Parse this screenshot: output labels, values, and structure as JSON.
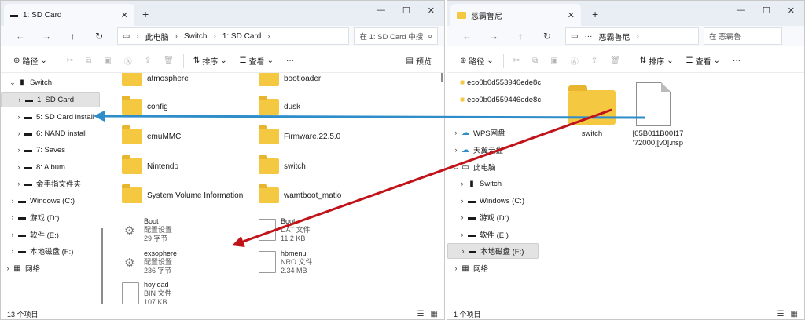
{
  "colors": {
    "blue_arrow": "#2f8ec9",
    "red_arrow": "#c0131a",
    "folder": "#f5c842"
  },
  "left": {
    "tab_title": "1: SD Card",
    "nav_buttons": [
      "←",
      "→",
      "↑",
      "↻"
    ],
    "breadcrumb": [
      "此电脑",
      "Switch",
      "1: SD Card"
    ],
    "search_placeholder": "在 1: SD Card 中搜",
    "toolbar": {
      "path": "路径",
      "sort": "排序",
      "view": "查看",
      "more": "···",
      "preview": "预览"
    },
    "nav_items": [
      {
        "label": "Switch",
        "chev": "⌄"
      },
      {
        "label": "1: SD Card",
        "chev": "›"
      },
      {
        "label": "5: SD Card install",
        "chev": "›"
      },
      {
        "label": "6: NAND install",
        "chev": "›"
      },
      {
        "label": "7: Saves",
        "chev": "›"
      },
      {
        "label": "8: Album",
        "chev": "›"
      },
      {
        "label": "金手指文件夹",
        "chev": "›"
      },
      {
        "label": "Windows (C:)",
        "chev": "›"
      },
      {
        "label": "游戏 (D:)",
        "chev": "›"
      },
      {
        "label": "软件 (E:)",
        "chev": "›"
      },
      {
        "label": "本地磁盘 (F:)",
        "chev": "›"
      },
      {
        "label": "网络",
        "chev": "›"
      }
    ],
    "folders_col1": [
      "atmosphere",
      "config",
      "emuMMC",
      "Nintendo",
      "System Volume Information"
    ],
    "folders_col2": [
      "bootloader",
      "dusk",
      "Firmware.22.5.0",
      "switch",
      "wamtboot_matio"
    ],
    "files_col1": [
      {
        "name": "Boot",
        "type": "配置设置",
        "size": "29 字节"
      },
      {
        "name": "exsophere",
        "type": "配置设置",
        "size": "236 字节"
      },
      {
        "name": "hoyload",
        "type": "BIN 文件",
        "size": "107 KB"
      }
    ],
    "files_col2": [
      {
        "name": "Boot",
        "type": "DAT 文件",
        "size": "11.2 KB"
      },
      {
        "name": "hbmenu",
        "type": "NRO 文件",
        "size": "2.34 MB"
      }
    ],
    "status": "13 个项目"
  },
  "right": {
    "tab_title": "恶霸鲁尼",
    "nav_buttons": [
      "←",
      "→",
      "↑",
      "↻"
    ],
    "breadcrumb": [
      "···",
      "恶霸鲁尼"
    ],
    "search_placeholder": "在 恶霸鲁",
    "toolbar": {
      "path": "路径",
      "sort": "排序",
      "view": "查看",
      "more": "···"
    },
    "nav_items": [
      {
        "label": "eco0b0d553946ede8c",
        "chev": ""
      },
      {
        "label": "eco0b0d559446ede8c",
        "chev": ""
      },
      {
        "label": "WPS网盘",
        "chev": "›"
      },
      {
        "label": "天翼云盘",
        "chev": "›"
      },
      {
        "label": "此电脑",
        "chev": "⌄"
      },
      {
        "label": "Switch",
        "chev": "›"
      },
      {
        "label": "Windows (C:)",
        "chev": "›"
      },
      {
        "label": "游戏 (D:)",
        "chev": "›"
      },
      {
        "label": "软件 (E:)",
        "chev": "›"
      },
      {
        "label": "本地磁盘 (F:)",
        "chev": "›"
      },
      {
        "label": "网络",
        "chev": "›"
      }
    ],
    "folder_label": "switch",
    "file_label_line1": "[05B011B00I17",
    "file_label_line2": "'72000][v0].nsp",
    "status": "1 个项目"
  }
}
